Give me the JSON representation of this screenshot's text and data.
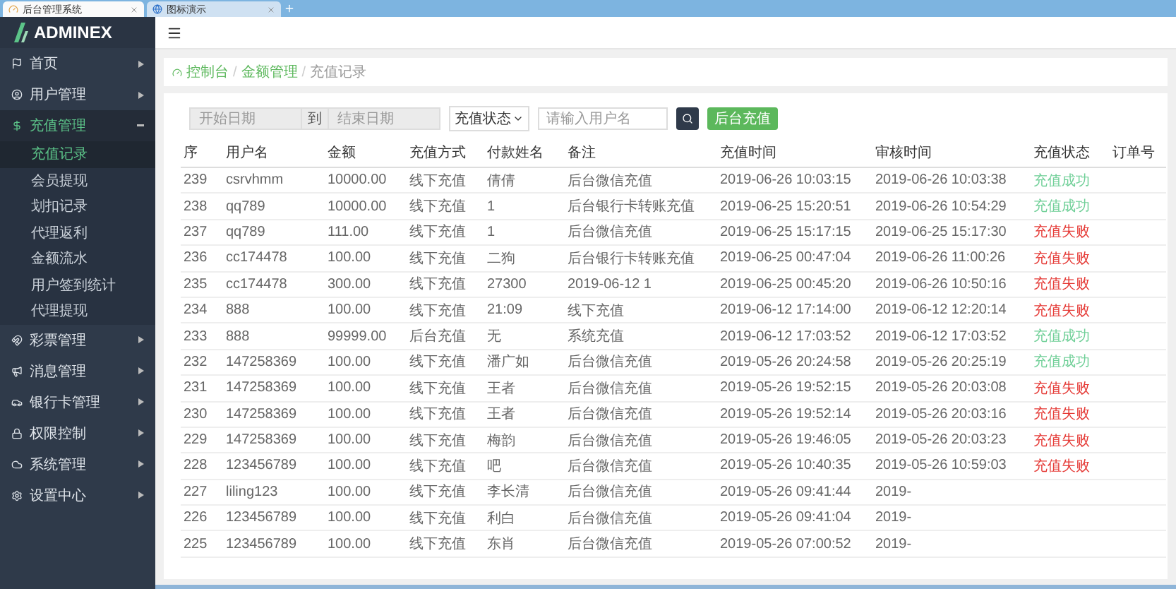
{
  "browser_tabs": [
    {
      "title": "后台管理系统",
      "selected": true
    },
    {
      "title": "图标演示",
      "selected": false
    }
  ],
  "logo": "ADMINEX",
  "sidebar": {
    "items": [
      {
        "label": "首页",
        "expanded": false,
        "selected": false
      },
      {
        "label": "用户管理",
        "expanded": false,
        "selected": false
      },
      {
        "label": "充值管理",
        "expanded": true,
        "selected": true,
        "children": [
          {
            "label": "充值记录",
            "selected": true
          },
          {
            "label": "会员提现",
            "selected": false
          },
          {
            "label": "划扣记录",
            "selected": false
          },
          {
            "label": "代理返利",
            "selected": false
          },
          {
            "label": "金额流水",
            "selected": false
          },
          {
            "label": "用户签到统计",
            "selected": false
          },
          {
            "label": "代理提现",
            "selected": false
          }
        ]
      },
      {
        "label": "彩票管理",
        "expanded": false,
        "selected": false
      },
      {
        "label": "消息管理",
        "expanded": false,
        "selected": false
      },
      {
        "label": "银行卡管理",
        "expanded": false,
        "selected": false
      },
      {
        "label": "权限控制",
        "expanded": false,
        "selected": false
      },
      {
        "label": "系统管理",
        "expanded": false,
        "selected": false
      },
      {
        "label": "设置中心",
        "expanded": false,
        "selected": false
      }
    ]
  },
  "breadcrumb": [
    "控制台",
    "金额管理",
    "充值记录"
  ],
  "breadcrumb_separator": "/",
  "filters": {
    "start_date": {
      "placeholder": "开始日期"
    },
    "to": "到",
    "end_date": {
      "placeholder": "结束日期"
    },
    "status_select": "充值状态",
    "username": {
      "placeholder": "请输入用户名"
    },
    "add_button": "后台充值"
  },
  "table": {
    "columns": [
      "序",
      "用户名",
      "金额",
      "充值方式",
      "付款姓名",
      "备注",
      "充值时间",
      "审核时间",
      "充值状态",
      "订单号"
    ],
    "rows": [
      {
        "cells": [
          "239",
          "csrvhmm",
          "10000.00",
          "线下充值",
          "倩倩",
          "后台微信充值",
          "2019-06-26 10:03:15",
          "2019-06-26 10:03:38"
        ],
        "status": "充值成功",
        "success": true
      },
      {
        "cells": [
          "238",
          "qq789",
          "10000.00",
          "线下充值",
          "1",
          "后台银行卡转账充值",
          "2019-06-25 15:20:51",
          "2019-06-26 10:54:29"
        ],
        "status": "充值成功",
        "success": true
      },
      {
        "cells": [
          "237",
          "qq789",
          "111.00",
          "线下充值",
          "1",
          "后台微信充值",
          "2019-06-25 15:17:15",
          "2019-06-25 15:17:30"
        ],
        "status": "充值失败",
        "success": false
      },
      {
        "cells": [
          "236",
          "cc174478",
          "100.00",
          "线下充值",
          "二狗",
          "后台银行卡转账充值",
          "2019-06-25 00:47:04",
          "2019-06-26 11:00:26"
        ],
        "status": "充值失败",
        "success": false
      },
      {
        "cells": [
          "235",
          "cc174478",
          "300.00",
          "线下充值",
          "27300",
          "2019-06-12 1",
          "2019-06-25 00:45:20",
          "2019-06-26 10:50:16"
        ],
        "status": "充值失败",
        "success": false
      },
      {
        "cells": [
          "234",
          "888",
          "100.00",
          "线下充值",
          "21:09",
          "线下充值",
          "2019-06-12 17:14:00",
          "2019-06-12 12:20:14"
        ],
        "status": "充值失败",
        "success": false
      },
      {
        "cells": [
          "233",
          "888",
          "99999.00",
          "后台充值",
          "无",
          "系统充值",
          "2019-06-12 17:03:52",
          "2019-06-12 17:03:52"
        ],
        "status": "充值成功",
        "success": true
      },
      {
        "cells": [
          "232",
          "147258369",
          "100.00",
          "线下充值",
          "潘广如",
          "后台微信充值",
          "2019-05-26 20:24:58",
          "2019-05-26 20:25:19"
        ],
        "status": "充值成功",
        "success": true
      },
      {
        "cells": [
          "231",
          "147258369",
          "100.00",
          "线下充值",
          "王者",
          "后台微信充值",
          "2019-05-26 19:52:15",
          "2019-05-26 20:03:08"
        ],
        "status": "充值失败",
        "success": false
      },
      {
        "cells": [
          "230",
          "147258369",
          "100.00",
          "线下充值",
          "王者",
          "后台微信充值",
          "2019-05-26 19:52:14",
          "2019-05-26 20:03:16"
        ],
        "status": "充值失败",
        "success": false
      },
      {
        "cells": [
          "229",
          "147258369",
          "100.00",
          "线下充值",
          "梅韵",
          "后台微信充值",
          "2019-05-26 19:46:05",
          "2019-05-26 20:03:23"
        ],
        "status": "充值失败",
        "success": false
      },
      {
        "cells": [
          "228",
          "123456789",
          "100.00",
          "线下充值",
          "吧",
          "后台微信充值",
          "2019-05-26 10:40:35",
          "2019-05-26 10:59:03"
        ],
        "status": "充值失败",
        "success": false
      },
      {
        "cells": [
          "227",
          "liling123",
          "100.00",
          "线下充值",
          "李长清",
          "后台微信充值",
          "2019-05-26 09:41:44",
          "2019-"
        ]
      },
      {
        "cells": [
          "226",
          "123456789",
          "100.00",
          "线下充值",
          "利白",
          "后台微信充值",
          "2019-05-26 09:41:04",
          "2019-"
        ]
      },
      {
        "cells": [
          "225",
          "123456789",
          "100.00",
          "线下充值",
          "东肖",
          "后台微信充值",
          "2019-05-26 07:00:52",
          "2019-"
        ]
      }
    ]
  }
}
